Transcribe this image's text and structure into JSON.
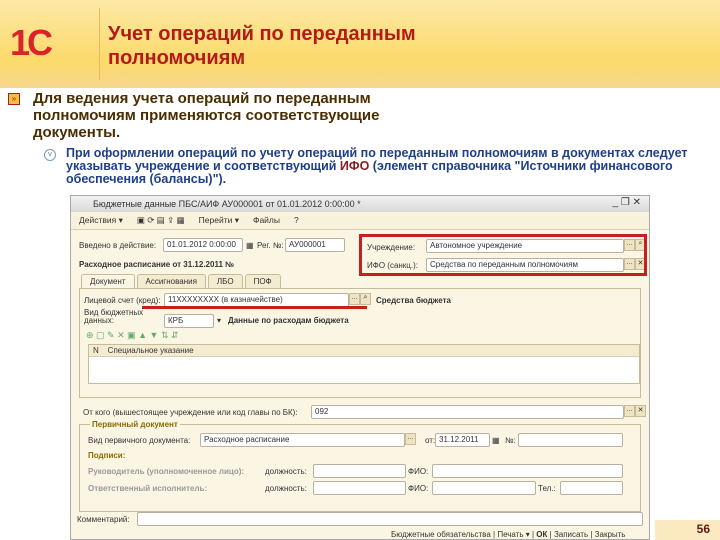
{
  "header": {
    "logo": "1С",
    "title_line1": "Учет операций по переданным",
    "title_line2": "полномочиям"
  },
  "bullets": {
    "main": "Для ведения учета операций по переданным полномочиям применяются соответствующие документы.",
    "sub_before": "При оформлении операций по учету операций по переданным полномочиям в документах следует указывать учреждение и соответствующий ",
    "sub_highlight": "ИФО",
    "sub_after": " (элемент справочника \"Источники финансового обеспечения (балансы)\")."
  },
  "window": {
    "title": "Бюджетные данные ПБС/АИФ АУ000001 от 01.01.2012 0:00:00 *",
    "controls": "_ ❐ ✕",
    "toolbar": [
      "Действия ▾",
      "Перейти ▾",
      "Файлы"
    ],
    "fields": {
      "enter_label": "Введено в действие:",
      "enter_value": "01.01.2012 0:00:00",
      "num_label": "Рег. №:",
      "num_value": "АУ000001",
      "inst_label": "Учреждение:",
      "inst_value": "Автономное учреждение",
      "ifo_label": "ИФО (санкц.):",
      "ifo_value": "Средства по переданным полномочиям",
      "schedule": "Расходное расписание от 31.12.2011 №"
    },
    "tabs": [
      "Документ",
      "Ассигнования",
      "ЛБО",
      "ПОФ"
    ],
    "account_label": "Лицевой счет (кред):",
    "account_value": "11ХХХХХХХХ (в казначействе)",
    "funds": "Средства бюджета",
    "type_label": "Вид бюджетных данных:",
    "type_value": "КРБ",
    "expense_data": "Данные по расходам бюджета",
    "grid_headers": [
      "N",
      "Специальное указание"
    ],
    "from_label": "От кого (вышестоящее учреждение или код главы по БК):",
    "from_value": "092",
    "primary_doc": "Первичный документ",
    "doc_type_label": "Вид первичного документа:",
    "doc_type_value": "Расходное расписание",
    "from_date_label": "от:",
    "date_value": "31.12.2011",
    "no_label": "№:",
    "signatures": "Подписи:",
    "head_label": "Руководитель (уполномоченное лицо):",
    "position_label": "должность:",
    "fio_label": "ФИО:",
    "exec_label": "Ответственный исполнитель:",
    "tel_label": "Тел.:",
    "comment_label": "Комментарий:",
    "bottom_buttons": [
      "Бюджетные обязательства",
      "Печать ▾",
      "ОК",
      "Записать",
      "Закрыть"
    ]
  },
  "page_number": "56"
}
